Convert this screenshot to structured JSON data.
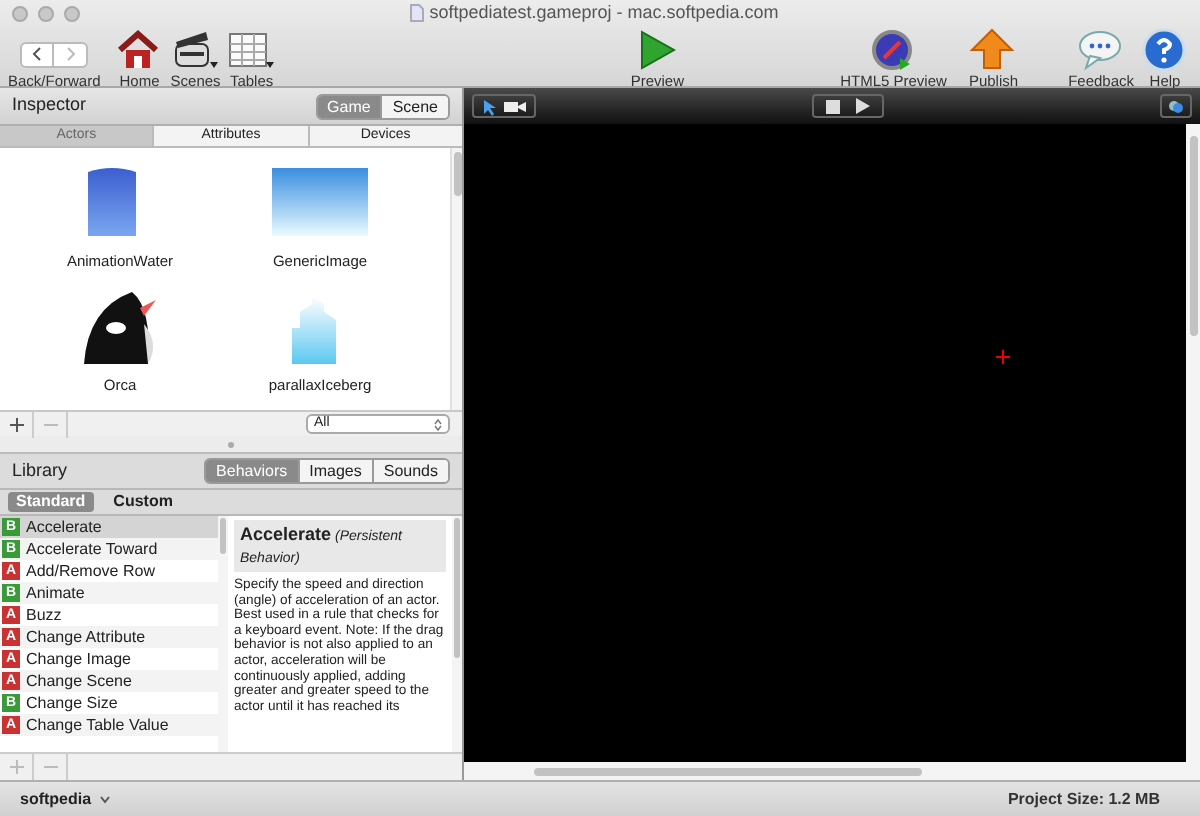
{
  "window": {
    "title": "softpediatest.gameproj - mac.softpedia.com"
  },
  "toolbar": {
    "left": [
      {
        "label": "Back/Forward",
        "kind": "nav"
      },
      {
        "label": "Home",
        "kind": "home"
      },
      {
        "label": "Scenes",
        "kind": "scenes"
      },
      {
        "label": "Tables",
        "kind": "tables"
      }
    ],
    "center": [
      {
        "label": "Preview",
        "kind": "preview"
      }
    ],
    "right": [
      {
        "label": "HTML5 Preview",
        "kind": "html5"
      },
      {
        "label": "Publish",
        "kind": "publish"
      },
      {
        "label": "Feedback",
        "kind": "feedback"
      },
      {
        "label": "Help",
        "kind": "help"
      }
    ]
  },
  "inspector": {
    "title": "Inspector",
    "modes": [
      {
        "label": "Game",
        "selected": true
      },
      {
        "label": "Scene",
        "selected": false
      }
    ],
    "tabs": [
      {
        "label": "Actors",
        "selected": true
      },
      {
        "label": "Attributes",
        "selected": false
      },
      {
        "label": "Devices",
        "selected": false
      }
    ],
    "actors": [
      {
        "name": "AnimationWater",
        "kind": "water"
      },
      {
        "name": "GenericImage",
        "kind": "gradient"
      },
      {
        "name": "Orca",
        "kind": "orca"
      },
      {
        "name": "parallaxIceberg",
        "kind": "iceberg"
      }
    ],
    "filter": "All"
  },
  "library": {
    "title": "Library",
    "tabs": [
      {
        "label": "Behaviors",
        "selected": true
      },
      {
        "label": "Images",
        "selected": false
      },
      {
        "label": "Sounds",
        "selected": false
      }
    ],
    "modes": [
      {
        "label": "Standard",
        "selected": true
      },
      {
        "label": "Custom",
        "selected": false
      }
    ],
    "behaviors": [
      {
        "badge": "B",
        "name": "Accelerate",
        "selected": true,
        "color": "#3a9a3a"
      },
      {
        "badge": "B",
        "name": "Accelerate Toward",
        "selected": false,
        "color": "#3a9a3a"
      },
      {
        "badge": "A",
        "name": "Add/Remove Row",
        "selected": false,
        "color": "#c83232"
      },
      {
        "badge": "B",
        "name": "Animate",
        "selected": false,
        "color": "#3a9a3a"
      },
      {
        "badge": "A",
        "name": "Buzz",
        "selected": false,
        "color": "#c83232"
      },
      {
        "badge": "A",
        "name": "Change Attribute",
        "selected": false,
        "color": "#c83232"
      },
      {
        "badge": "A",
        "name": "Change Image",
        "selected": false,
        "color": "#c83232"
      },
      {
        "badge": "A",
        "name": "Change Scene",
        "selected": false,
        "color": "#c83232"
      },
      {
        "badge": "B",
        "name": "Change Size",
        "selected": false,
        "color": "#3a9a3a"
      },
      {
        "badge": "A",
        "name": "Change Table Value",
        "selected": false,
        "color": "#c83232"
      }
    ],
    "description": {
      "title": "Accelerate",
      "subtitle": "(Persistent Behavior)",
      "text": "Specify the speed and direction (angle) of acceleration of an actor. Best used in a rule that checks for a keyboard event. Note: If the drag behavior is not also applied to an actor, acceleration will be continuously applied, adding greater and greater speed to the actor until it has reached its"
    }
  },
  "status_bar": {
    "account": "softpedia",
    "project_size": "Project Size: 1.2 MB"
  }
}
